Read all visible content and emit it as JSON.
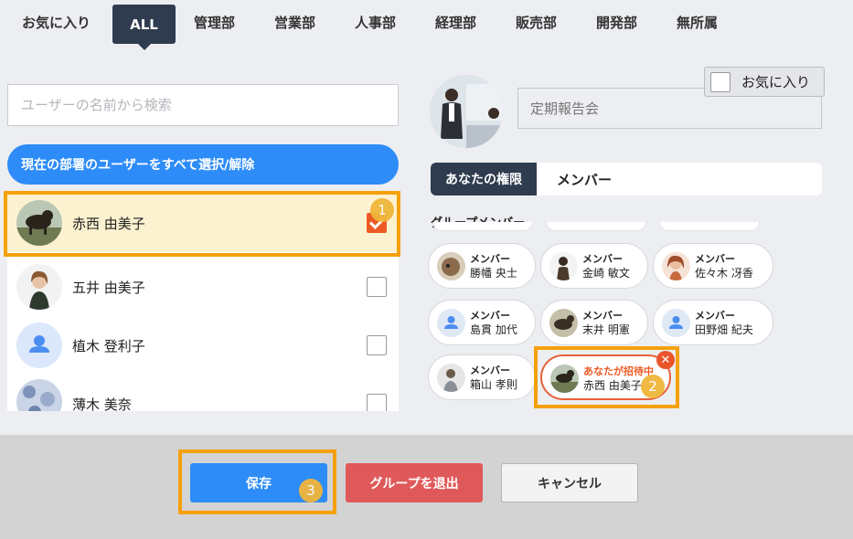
{
  "tabs": [
    {
      "label": "お気に入り",
      "active": false
    },
    {
      "label": "ALL",
      "active": true
    },
    {
      "label": "管理部",
      "active": false
    },
    {
      "label": "営業部",
      "active": false
    },
    {
      "label": "人事部",
      "active": false
    },
    {
      "label": "経理部",
      "active": false
    },
    {
      "label": "販売部",
      "active": false
    },
    {
      "label": "開発部",
      "active": false
    },
    {
      "label": "無所属",
      "active": false
    }
  ],
  "search": {
    "placeholder": "ユーザーの名前から検索",
    "value": ""
  },
  "select_all_label": "現在の部署のユーザーをすべて選択/解除",
  "users": [
    {
      "name": "赤西 由美子",
      "checked": true,
      "avatar": "dog-photo"
    },
    {
      "name": "五井 由美子",
      "checked": false,
      "avatar": "woman-photo"
    },
    {
      "name": "植木 登利子",
      "checked": false,
      "avatar": "default-person-icon"
    },
    {
      "name": "薄木 美奈",
      "checked": false,
      "avatar": "pattern-photo"
    }
  ],
  "group": {
    "name_placeholder": "定期報告会",
    "favorite_label": "お気に入り",
    "favorite_checked": false,
    "permission_label": "あなたの権限",
    "permission_value": "メンバー",
    "members_label": "グループメンバー"
  },
  "members": [
    {
      "role": "メンバー",
      "name": "勝幡 央士",
      "avatar": "cat-photo"
    },
    {
      "role": "メンバー",
      "name": "金崎 敏文",
      "avatar": "man-photo"
    },
    {
      "role": "メンバー",
      "name": "佐々木 冴香",
      "avatar": "woman-photo"
    },
    {
      "role": "メンバー",
      "name": "島貫 加代",
      "avatar": "default-person-icon"
    },
    {
      "role": "メンバー",
      "name": "末井 明憲",
      "avatar": "dog-photo"
    },
    {
      "role": "メンバー",
      "name": "田野畑 紀夫",
      "avatar": "default-person-icon"
    },
    {
      "role": "メンバー",
      "name": "箱山 孝則",
      "avatar": "man-photo"
    },
    {
      "role": "あなたが招待中",
      "name": "赤西 由美子",
      "avatar": "dog-photo",
      "invited": true
    }
  ],
  "buttons": {
    "save": "保存",
    "leave": "グループを退出",
    "cancel": "キャンセル"
  },
  "markers": [
    "1",
    "2",
    "3"
  ],
  "colors": {
    "primary": "#2d8cf7",
    "navy": "#2f3c4f",
    "danger": "#e0595a",
    "invite": "#ec5a24",
    "highlight": "#f5a00b"
  }
}
